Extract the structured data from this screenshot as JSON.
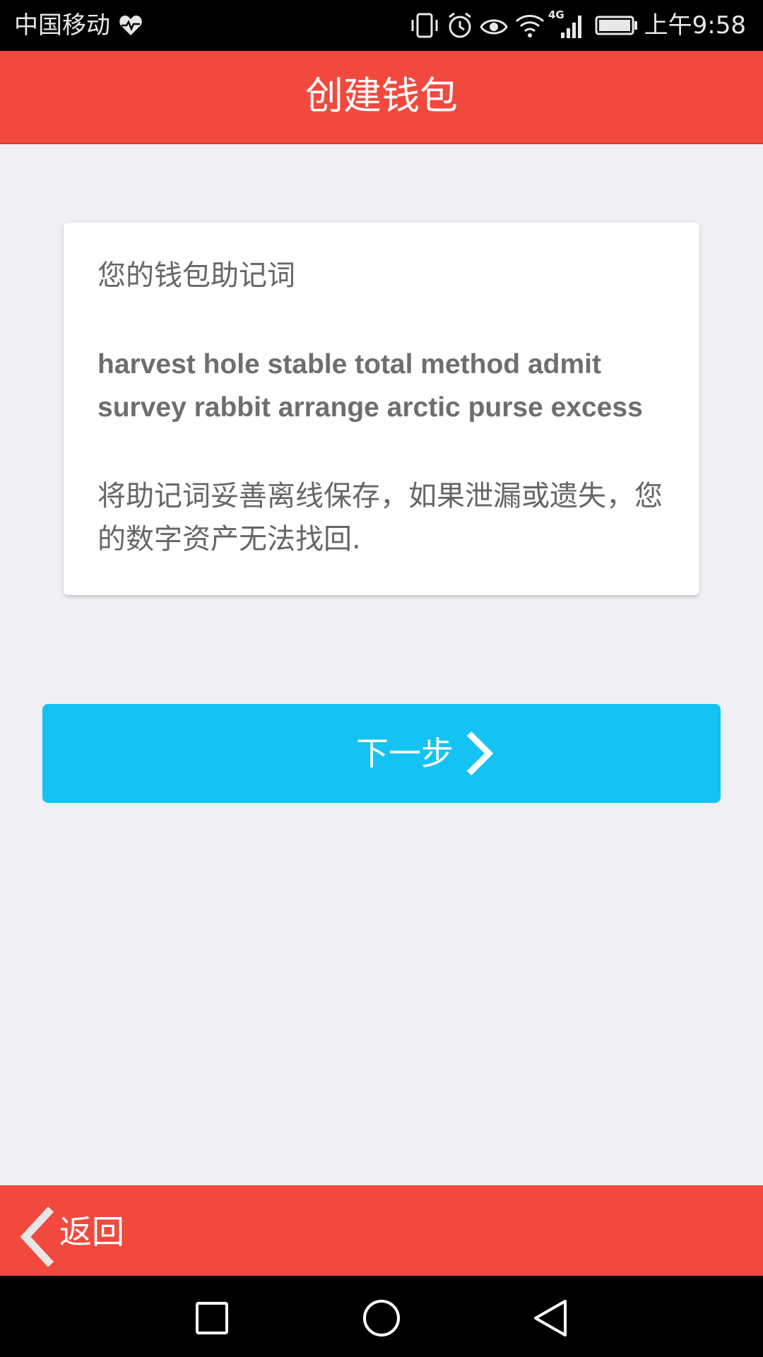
{
  "status_bar": {
    "carrier": "中国移动",
    "time": "上午9:58",
    "network": "4G",
    "icons": [
      "heart-icon",
      "vibrate-icon",
      "alarm-icon",
      "eye-icon",
      "wifi-icon",
      "signal-icon",
      "battery-icon"
    ]
  },
  "header": {
    "title": "创建钱包"
  },
  "card": {
    "label": "您的钱包助记词",
    "mnemonic": "harvest hole stable total method admit survey rabbit arrange arctic purse excess",
    "warning": "将助记词妥善离线保存，如果泄漏或遗失，您的数字资产无法找回."
  },
  "actions": {
    "next_label": "下一步",
    "back_label": "返回"
  },
  "colors": {
    "header_bg": "#F1493D",
    "button_bg": "#14C3F3",
    "page_bg": "#EFEFF4",
    "card_bg": "#FFFFFF",
    "text_gray": "#666666"
  },
  "nav_bar": {
    "buttons": [
      "recents-square-icon",
      "home-circle-icon",
      "back-triangle-icon"
    ]
  }
}
